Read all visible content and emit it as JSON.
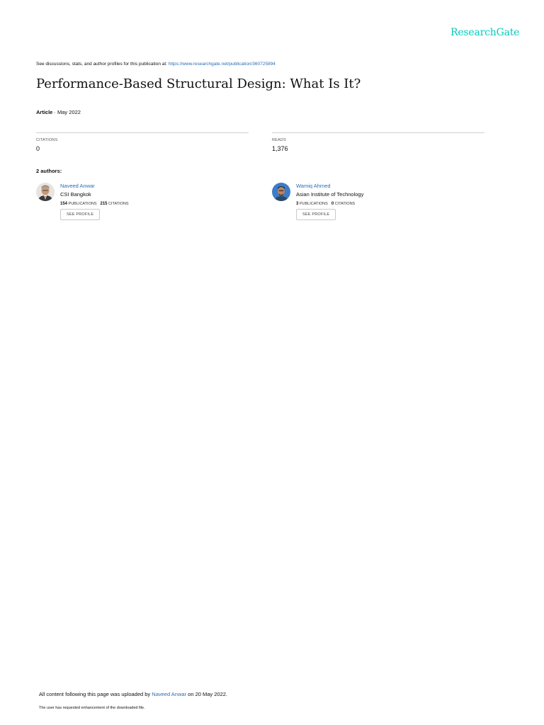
{
  "brand": {
    "logo_text": "ResearchGate",
    "accent": "#00ccbb",
    "link_color": "#2a6db3"
  },
  "header": {
    "discussions_text": "See discussions, stats, and author profiles for this publication at: ",
    "publication_url": "https://www.researchgate.net/publication/360725894"
  },
  "publication": {
    "title": "Performance-Based Structural Design: What Is It?",
    "type": "Article",
    "date_sep": " · ",
    "date": "May 2022"
  },
  "stats": {
    "citations": {
      "label": "CITATIONS",
      "value": "0"
    },
    "reads": {
      "label": "READS",
      "value": "1,376"
    }
  },
  "authors_heading": "2 authors:",
  "authors": [
    {
      "name": "Naveed Anwar",
      "institution": "CSI Bangkok",
      "publications": "154",
      "publications_label": "PUBLICATIONS",
      "citations": "215",
      "citations_label": "CITATIONS",
      "button": "SEE PROFILE"
    },
    {
      "name": "Wamiq Ahmed",
      "institution": "Asian Institute of Technology",
      "publications": "3",
      "publications_label": "PUBLICATIONS",
      "citations": "0",
      "citations_label": "CITATIONS",
      "button": "SEE PROFILE"
    }
  ],
  "footer": {
    "upload_prefix": "All content following this page was uploaded by ",
    "uploader": "Naveed Anwar",
    "upload_suffix": " on 20 May 2022.",
    "note": "The user has requested enhancement of the downloaded file."
  }
}
